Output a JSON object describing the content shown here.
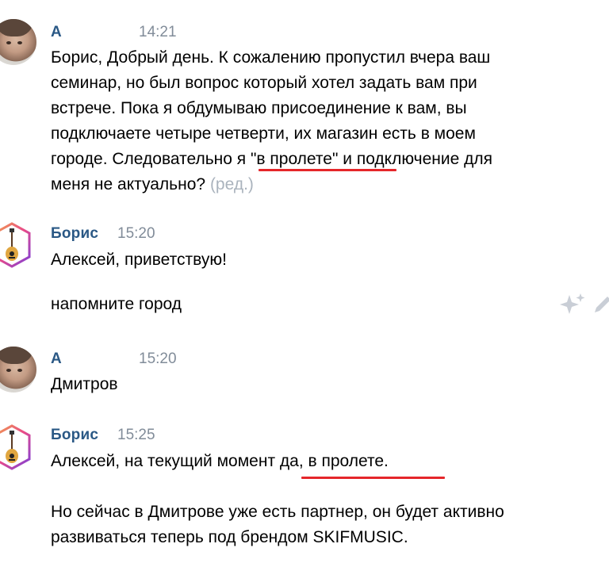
{
  "messages": [
    {
      "author": "А",
      "time": "14:21",
      "lines": [
        "Борис, Добрый день. К сожалению пропустил вчера ваш",
        "семинар, но был вопрос который хотел задать вам при",
        "встрече. Пока я обдумываю присоединение к вам, вы",
        "подключаете четыре четверти, их магазин есть в моем",
        "городе. Следовательно я \"в пролете\" и подключение для",
        "меня не актуально?"
      ],
      "edited_label": "(ред.)"
    },
    {
      "author": "Борис",
      "time": "15:20",
      "lines": [
        "Алексей, приветствую!"
      ]
    },
    {
      "author": "Борис",
      "time": "",
      "lines": [
        "напомните город"
      ]
    },
    {
      "author": "А",
      "time": "15:20",
      "lines": [
        "Дмитров"
      ]
    },
    {
      "author": "Борис",
      "time": "15:25",
      "lines": [
        "Алексей, на текущий момент да, в пролете.",
        "",
        "Но сейчас в Дмитрове уже есть партнер, он будет активно",
        "развиваться теперь под брендом SKIFMUSIC."
      ]
    }
  ],
  "icons": {
    "avatar_a": "user-photo-avatar",
    "avatar_boris": "guitar-hexagon-avatar",
    "sparkle": "sparkle-icon",
    "edit": "pencil-icon"
  },
  "colors": {
    "author": "#2a5885",
    "time": "#818c99",
    "edited": "#aab3bd",
    "highlight": "#e5262a"
  }
}
